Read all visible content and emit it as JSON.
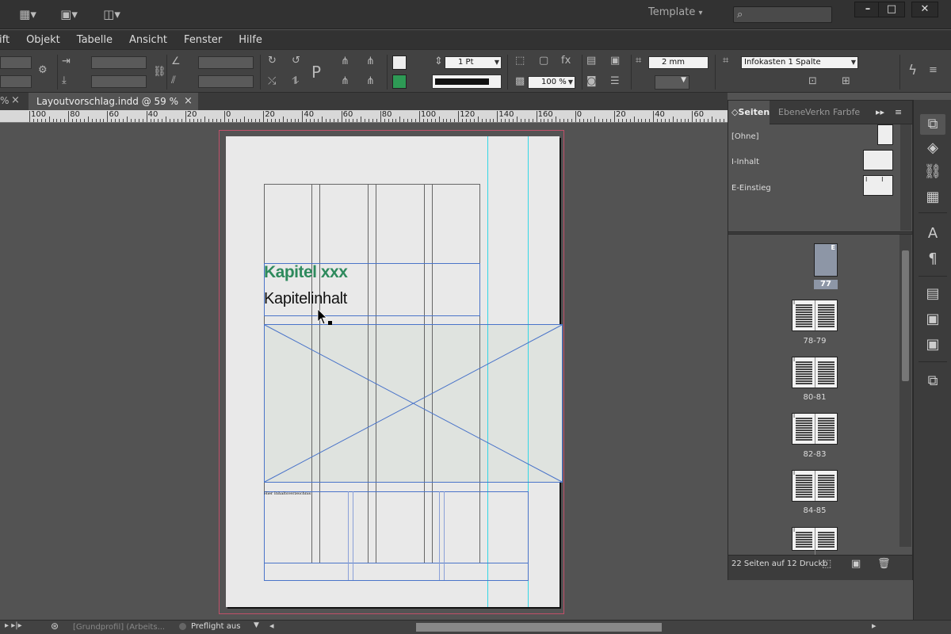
{
  "titlebar": {
    "workspace": "Template",
    "workspace_arrow": "▾",
    "search_placeholder": "",
    "search_icon": "search-icon",
    "minimize": "–",
    "restore": "□",
    "close": "✕",
    "icons": [
      "bridge-icon",
      "screen-mode-icon",
      "arrange-documents-icon"
    ]
  },
  "menu": [
    "ift",
    "Objekt",
    "Tabelle",
    "Ansicht",
    "Fenster",
    "Hilfe"
  ],
  "control": {
    "stroke_weight": "1 Pt",
    "zoom": "100 %",
    "offset": "2 mm",
    "object_style": "Infokasten 1 Spalte"
  },
  "tab": {
    "title": "Layoutvorschlag.indd @ 59 %",
    "close": "×",
    "left_fragment": "%"
  },
  "ruler": {
    "labels": [
      "100",
      "80",
      "60",
      "40",
      "20",
      "0",
      "20",
      "40",
      "60",
      "80",
      "100",
      "120",
      "140",
      "160",
      "0",
      "20",
      "40",
      "60",
      "80"
    ]
  },
  "page": {
    "heading": "Kapitel xxx",
    "subheading": "Kapitelinhalt",
    "small_text": "Hier Inhaltsverzeichnis"
  },
  "panel": {
    "tabs": [
      "Seiten",
      "Ebene",
      "Verkn",
      "Farbfe"
    ],
    "masters": [
      {
        "name": "[Ohne]"
      },
      {
        "name": "I-Inhalt"
      },
      {
        "name": "E-Einstieg"
      }
    ],
    "pages": [
      {
        "label": "77",
        "letter": "E"
      },
      {
        "label": "78-79",
        "letter": "I"
      },
      {
        "label": "80-81",
        "letter": "I"
      },
      {
        "label": "82-83",
        "letter": "I"
      },
      {
        "label": "84-85",
        "letter": "I"
      }
    ],
    "footer": "22 Seiten auf 12 Druckb"
  },
  "status": {
    "profile": "[Grundprofil] (Arbeits...",
    "preflight": "Preflight aus"
  },
  "colors": {
    "accent_green": "#2e8a5d",
    "bleed_red": "#c05069",
    "guide_cyan": "#33d6e6",
    "frame_blue": "#4a74c9"
  }
}
